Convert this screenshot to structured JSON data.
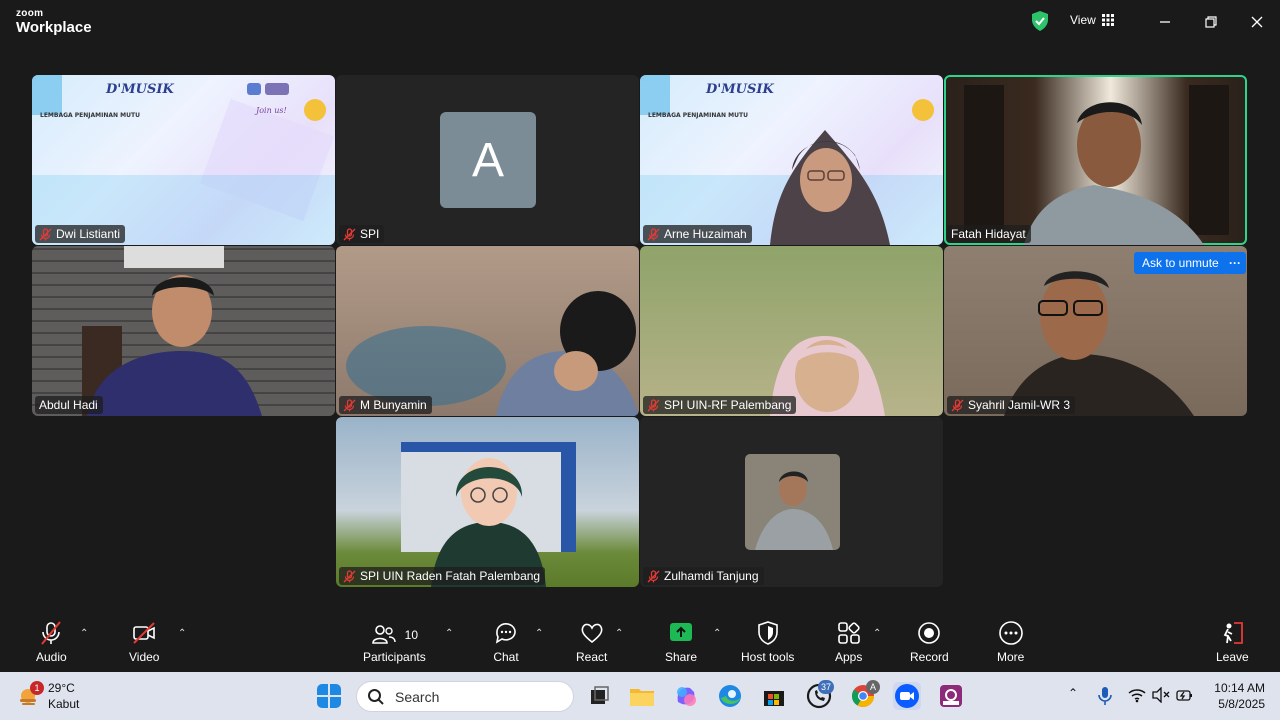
{
  "app": {
    "brand_small": "zoom",
    "brand_large": "Workplace",
    "view_label": "View"
  },
  "participants": [
    {
      "name": "Dwi Listianti",
      "muted": true
    },
    {
      "name": "SPI",
      "muted": true,
      "avatar_letter": "A"
    },
    {
      "name": "Arne Huzaimah",
      "muted": true
    },
    {
      "name": "Fatah Hidayat",
      "muted": false,
      "speaking": true
    },
    {
      "name": "Abdul Hadi",
      "muted": false
    },
    {
      "name": "M Bunyamin",
      "muted": true
    },
    {
      "name": "SPI UIN-RF Palembang",
      "muted": true
    },
    {
      "name": "Syahril Jamil-WR 3",
      "muted": true
    },
    {
      "name": "SPI UIN Raden Fatah Palembang",
      "muted": true
    },
    {
      "name": "Zulhamdi Tanjung",
      "muted": true
    }
  ],
  "banner": {
    "title": "D'MUSIK",
    "subtitle": "LEMBAGA PENJAMINAN MUTU",
    "join": "Join us!"
  },
  "ask_unmute": "Ask to unmute",
  "more_dots": "···",
  "toolbar": {
    "audio": "Audio",
    "video": "Video",
    "participants": "Participants",
    "participants_count": "10",
    "chat": "Chat",
    "react": "React",
    "share": "Share",
    "host_tools": "Host tools",
    "apps": "Apps",
    "record": "Record",
    "more": "More",
    "leave": "Leave"
  },
  "taskbar": {
    "temperature": "29°C",
    "weather": "Kabut",
    "weather_badge": "1",
    "search_placeholder": "Search",
    "whatsapp_badge": "37",
    "chrome_badge": "A",
    "time": "10:14 AM",
    "date": "5/8/2025"
  },
  "colors": {
    "active_speaker": "#2dd489",
    "accent": "#0e72ed",
    "share": "#1db954",
    "muted": "#e53935"
  }
}
